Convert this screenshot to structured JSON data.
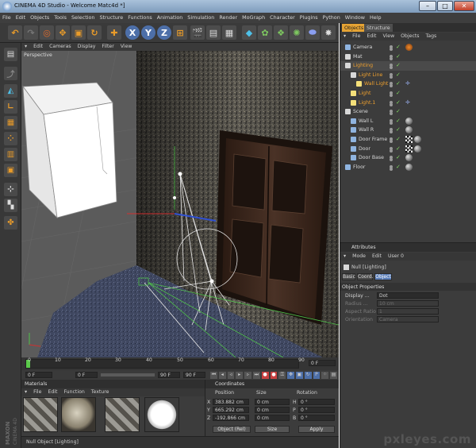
{
  "window": {
    "title": "CINEMA 4D Studio - Welcome Matc4d *]",
    "minimize": "–",
    "maximize": "□",
    "close": "✕"
  },
  "menubar": [
    "File",
    "Edit",
    "Objects",
    "Tools",
    "Selection",
    "Structure",
    "Functions",
    "Animation",
    "Simulation",
    "Render",
    "MoGraph",
    "Character",
    "Plugins",
    "Python",
    "Window",
    "Help"
  ],
  "viewport": {
    "menu": [
      "Edit",
      "Cameras",
      "Display",
      "Filter",
      "View"
    ],
    "label": "Perspective"
  },
  "timeline": {
    "ticks": [
      "0",
      "10",
      "20",
      "30",
      "40",
      "50",
      "60",
      "70",
      "80",
      "90"
    ],
    "end_field": "0 F"
  },
  "playback": {
    "start": "0 F",
    "min": "0 F",
    "max": "90 F",
    "end": "90 F"
  },
  "materials": {
    "title": "Materials",
    "menu": [
      "File",
      "Edit",
      "Function",
      "Texture"
    ]
  },
  "coordinates": {
    "title": "Coordinates",
    "headers": [
      "Position",
      "Size",
      "Rotation"
    ],
    "rows": [
      {
        "axis": "X",
        "pos": "383.882 cm",
        "size": "0 cm",
        "rot_axis": "H",
        "rot": "0 °"
      },
      {
        "axis": "Y",
        "pos": "665.292 cm",
        "size": "0 cm",
        "rot_axis": "P",
        "rot": "0 °"
      },
      {
        "axis": "Z",
        "pos": "-192.866 cm",
        "size": "0 cm",
        "rot_axis": "B",
        "rot": "0 °"
      }
    ],
    "mode_select": "Object (Rel)",
    "size_select": "Size",
    "apply": "Apply"
  },
  "status": "Null Object [Lighting]",
  "objects_panel": {
    "tabs": [
      "Objects",
      "Structure"
    ],
    "menu": [
      "File",
      "Edit",
      "View",
      "Objects",
      "Tags"
    ],
    "rows": [
      {
        "name": "Camera",
        "indent": 0,
        "color": "#d8d8d8",
        "icon": "#8fb4e0",
        "tags": "camera"
      },
      {
        "name": "Mat",
        "indent": 0,
        "color": "#d8d8d8",
        "icon": "#d8d8d8",
        "tags": ""
      },
      {
        "name": "Lighting",
        "indent": 0,
        "color": "#f0a12e",
        "icon": "#d8d8d8",
        "tags": "",
        "selected": true
      },
      {
        "name": "Light Line",
        "indent": 1,
        "color": "#f0a12e",
        "icon": "#d8d8d8",
        "tags": ""
      },
      {
        "name": "Wall Light",
        "indent": 2,
        "color": "#f0a12e",
        "icon": "#f5e07a",
        "tags": "target"
      },
      {
        "name": "Light",
        "indent": 1,
        "color": "#f0a12e",
        "icon": "#f5e07a",
        "tags": "check"
      },
      {
        "name": "Light.1",
        "indent": 1,
        "color": "#f0a12e",
        "icon": "#f5e07a",
        "tags": "target"
      },
      {
        "name": "Scene",
        "indent": 0,
        "color": "#d8d8d8",
        "icon": "#d8d8d8",
        "tags": ""
      },
      {
        "name": "Wall L",
        "indent": 1,
        "color": "#d8d8d8",
        "icon": "#8fb4e0",
        "tags": "ball"
      },
      {
        "name": "Wall R",
        "indent": 1,
        "color": "#d8d8d8",
        "icon": "#8fb4e0",
        "tags": "ball"
      },
      {
        "name": "Door Frame",
        "indent": 1,
        "color": "#d8d8d8",
        "icon": "#8fb4e0",
        "tags": "checkball"
      },
      {
        "name": "Door",
        "indent": 1,
        "color": "#d8d8d8",
        "icon": "#8fb4e0",
        "tags": "checkball"
      },
      {
        "name": "Door Base",
        "indent": 1,
        "color": "#d8d8d8",
        "icon": "#8fb4e0",
        "tags": "ball"
      },
      {
        "name": "Floor",
        "indent": 0,
        "color": "#d8d8d8",
        "icon": "#8fb4e0",
        "tags": "ball"
      }
    ]
  },
  "attributes_panel": {
    "title": "Attributes",
    "menu": [
      "Mode",
      "Edit",
      "User 0"
    ],
    "object_label": "Null [Lighting]",
    "tabs": [
      "Basic",
      "Coord.",
      "Object"
    ],
    "section": "Object Properties",
    "props": [
      {
        "label": "Display ...",
        "value": "Dot",
        "enabled": true
      },
      {
        "label": "Radius ...",
        "value": "10 cm",
        "enabled": false
      },
      {
        "label": "Aspect Ratio",
        "value": "1",
        "enabled": false
      },
      {
        "label": "Orientation",
        "value": "Camera",
        "enabled": false
      }
    ]
  },
  "watermark": "pxleyes.com",
  "brand": "MAXON CINEMA 4D",
  "colors": {
    "accent": "#e5a334",
    "bg_panel": "#3c3c3c",
    "selected_text": "#f0a12e"
  }
}
